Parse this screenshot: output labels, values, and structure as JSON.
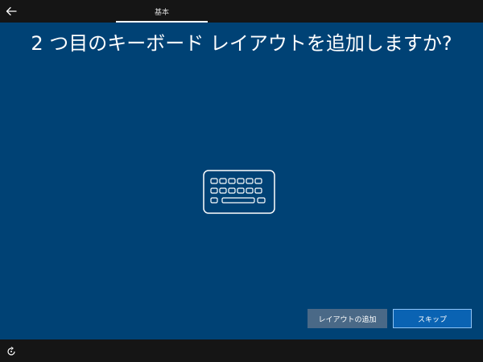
{
  "header": {
    "back_icon": "back-arrow-icon",
    "tab_label": "基本"
  },
  "main": {
    "title": "2 つ目のキーボード レイアウトを追加しますか?",
    "illustration_icon": "keyboard-icon"
  },
  "buttons": {
    "add_layout_label": "レイアウトの追加",
    "skip_label": "スキップ"
  },
  "footer": {
    "accessibility_icon": "ease-of-access-icon"
  },
  "colors": {
    "background": "#004275",
    "bar": "#151515",
    "primary_button": "#0a63b3",
    "secondary_button": "#4a6987"
  }
}
